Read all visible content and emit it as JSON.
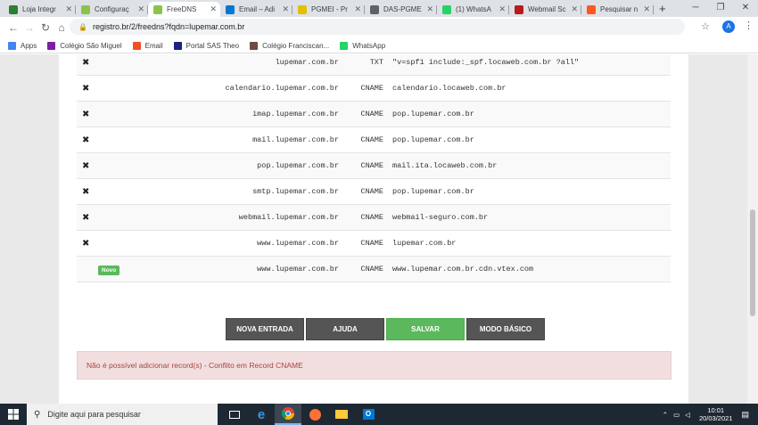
{
  "tabs": [
    {
      "title": "Loja Integr",
      "favicon_color": "#2e7d32"
    },
    {
      "title": "Configuraç",
      "favicon_color": "#8bc34a"
    },
    {
      "title": "FreeDNS",
      "favicon_color": "#8bc34a",
      "active": true
    },
    {
      "title": "Email – Adi",
      "favicon_color": "#0078d4"
    },
    {
      "title": "PGMEI - Pr",
      "favicon_color": "#e0c000"
    },
    {
      "title": "DAS-PGME",
      "favicon_color": "#5f6368"
    },
    {
      "title": "(1) WhatsA",
      "favicon_color": "#25d366"
    },
    {
      "title": "Webmail Sc",
      "favicon_color": "#b71c1c"
    },
    {
      "title": "Pesquisar n",
      "favicon_color": "#ff5722"
    }
  ],
  "browser": {
    "url": "registro.br/2/freedns?fqdn=lupemar.com.br",
    "new_tab": "+",
    "profile_initial": "A"
  },
  "bookmarks": [
    {
      "label": "Apps",
      "icon": "apps-grid-icon",
      "color": "#4285f4"
    },
    {
      "label": "Colégio São Miguel",
      "icon": "school-icon",
      "color": "#7b1fa2"
    },
    {
      "label": "Email",
      "icon": "windows-icon",
      "color": "#f25022"
    },
    {
      "label": "Portal SAS Theo",
      "icon": "sas-icon",
      "color": "#1a237e"
    },
    {
      "label": "Colégio Franciscan...",
      "icon": "school-icon",
      "color": "#6d4c41"
    },
    {
      "label": "WhatsApp",
      "icon": "whatsapp-icon",
      "color": "#25d366"
    }
  ],
  "records": [
    {
      "action": "✖",
      "host": "lupemar.com.br",
      "type": "TXT",
      "value": "\"v=spf1 include:_spf.locaweb.com.br ?all\""
    },
    {
      "action": "✖",
      "host": "calendario.lupemar.com.br",
      "type": "CNAME",
      "value": "calendario.locaweb.com.br"
    },
    {
      "action": "✖",
      "host": "imap.lupemar.com.br",
      "type": "CNAME",
      "value": "pop.lupemar.com.br"
    },
    {
      "action": "✖",
      "host": "mail.lupemar.com.br",
      "type": "CNAME",
      "value": "pop.lupemar.com.br"
    },
    {
      "action": "✖",
      "host": "pop.lupemar.com.br",
      "type": "CNAME",
      "value": "mail.ita.locaweb.com.br"
    },
    {
      "action": "✖",
      "host": "smtp.lupemar.com.br",
      "type": "CNAME",
      "value": "pop.lupemar.com.br"
    },
    {
      "action": "✖",
      "host": "webmail.lupemar.com.br",
      "type": "CNAME",
      "value": "webmail-seguro.com.br"
    },
    {
      "action": "✖",
      "host": "www.lupemar.com.br",
      "type": "CNAME",
      "value": "lupemar.com.br"
    },
    {
      "badge": "Novo",
      "host": "www.lupemar.com.br",
      "type": "CNAME",
      "value": "www.lupemar.com.br.cdn.vtex.com"
    }
  ],
  "buttons": {
    "new_entry": "NOVA ENTRADA",
    "help": "AJUDA",
    "save": "SALVAR",
    "basic_mode": "MODO BÁSICO"
  },
  "alert": "Não é possível adicionar record(s) - Conflito em Record CNAME",
  "taskbar": {
    "search_placeholder": "Digite aqui para pesquisar",
    "time": "10:01",
    "date": "20/03/2021"
  },
  "colors": {
    "save_green": "#5cb85c",
    "dark_button": "#555555",
    "alert_bg": "#f2dede",
    "alert_text": "#a94442"
  }
}
